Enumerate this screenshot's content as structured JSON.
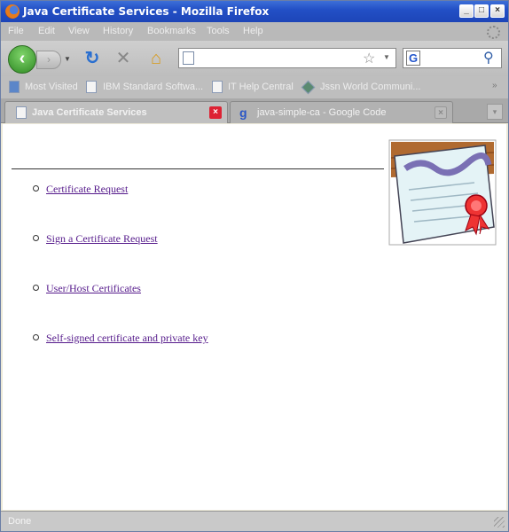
{
  "window": {
    "title": "Java Certificate Services - Mozilla Firefox"
  },
  "menu": [
    "File",
    "Edit",
    "View",
    "History",
    "Bookmarks",
    "Tools",
    "Help"
  ],
  "navbar": {
    "url_value": "",
    "search_engine_letter": "G"
  },
  "bookmarks": [
    {
      "label": "Most Visited",
      "icon": "most-visited-icon"
    },
    {
      "label": "IBM Standard Softwa...",
      "icon": "page-icon"
    },
    {
      "label": "IT Help Central",
      "icon": "page-icon"
    },
    {
      "label": "Jssn World Communi...",
      "icon": "diamond-icon"
    }
  ],
  "tabs": [
    {
      "label": "Java Certificate Services",
      "active": true
    },
    {
      "label": "java-simple-ca - Google Code",
      "active": false
    }
  ],
  "content": {
    "links": [
      "Certificate Request",
      "Sign a Certificate Request",
      "User/Host Certificates",
      "Self-signed certificate and private key"
    ]
  },
  "status": {
    "text": "Done"
  },
  "colors": {
    "title_bar": "#2350c6",
    "link_visited": "#551a8b",
    "tab_close": "#dd2233"
  }
}
